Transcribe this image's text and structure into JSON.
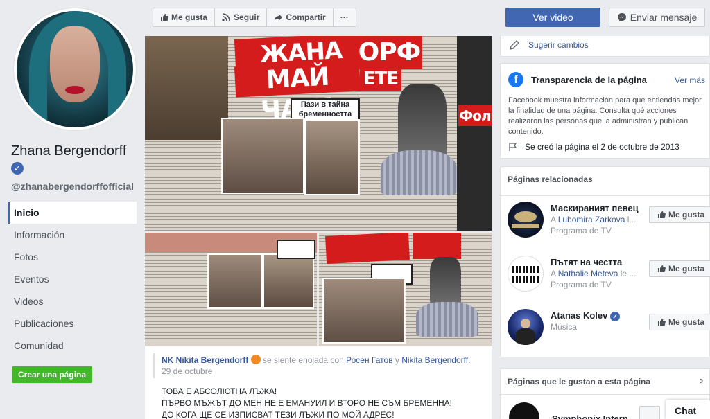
{
  "profile": {
    "name": "Zhana Bergendorff",
    "handle": "@zhanabergendorffofficial"
  },
  "nav": {
    "items": [
      {
        "label": "Inicio"
      },
      {
        "label": "Información"
      },
      {
        "label": "Fotos"
      },
      {
        "label": "Eventos"
      },
      {
        "label": "Videos"
      },
      {
        "label": "Publicaciones"
      },
      {
        "label": "Comunidad"
      }
    ],
    "create_page": "Crear una página"
  },
  "actions": {
    "like": "Me gusta",
    "follow": "Seguir",
    "share": "Compartir",
    "more": "···",
    "watch_video": "Ver video",
    "send_message": "Enviar mensaje"
  },
  "newspaper": {
    "headline1": "ЖАНА БЕРГЕН",
    "headline2": "МАЙ ЧАКА",
    "headline3": "ОРФ",
    "headline4": "ЕТЕ",
    "sub1": "Пази в тайна",
    "sub2": "бременността",
    "sub3": "Фол"
  },
  "post": {
    "author": "NK Nikita Bergendorff",
    "feeling": "se siente enojada con",
    "with1": "Росен Гатов",
    "conj": "y",
    "with2": "Nikita Bergendorff.",
    "date": "29 de octubre",
    "lines": [
      "ТОВА Е АБСОЛЮТНА ЛЪЖА!",
      "ПЪРВО МЪЖЪТ ДО МЕН НЕ Е ЕМАНУИЛ И ВТОРО НЕ СЪМ БРЕМЕННА!",
      "ДО КОГА ЩЕ СЕ ИЗПИСВАТ ТЕЗИ ЛЪЖИ ПО МОЙ АДРЕС!"
    ]
  },
  "sidebar": {
    "suggest": "Sugerir cambios",
    "transparency": {
      "title": "Transparencia de la página",
      "more": "Ver más",
      "description": "Facebook muestra información para que entiendas mejor la finalidad de una página. Consulta qué acciones realizaron las personas que la administran y publican contenido.",
      "created": "Se creó la página el 2 de octubre de 2013"
    },
    "related": {
      "title": "Páginas relacionadas",
      "like_label": "Me gusta",
      "items": [
        {
          "name": "Маскираният певец",
          "prefix": "A",
          "liker": "Lubomira Zarkova",
          "suffix": "l...",
          "category": "Programa de TV"
        },
        {
          "name": "Пътят на честта",
          "prefix": "A",
          "liker": "Nathalie Meteva",
          "suffix": "le ...",
          "category": "Programa de TV"
        },
        {
          "name": "Atanas Kolev",
          "prefix": "",
          "liker": "",
          "suffix": "",
          "category": "Música"
        }
      ]
    },
    "liked_by": {
      "title": "Páginas que le gustan a esta página",
      "first": "Symphonix Intern"
    }
  },
  "chat": {
    "label": "Chat"
  }
}
